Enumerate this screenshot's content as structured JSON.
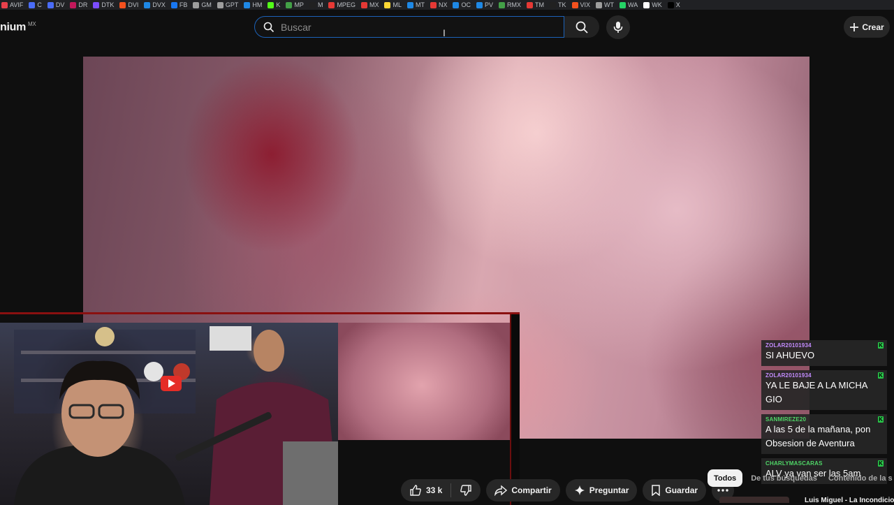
{
  "bookmarks": [
    {
      "label": "AVIF",
      "color": "#e8404b"
    },
    {
      "label": "C",
      "color": "#4a6cf7"
    },
    {
      "label": "DV",
      "color": "#4a6cf7"
    },
    {
      "label": "DR",
      "color": "#c2185b"
    },
    {
      "label": "DTK",
      "color": "#7c4dff"
    },
    {
      "label": "DVI",
      "color": "#f4511e"
    },
    {
      "label": "DVX",
      "color": "#1e88e5"
    },
    {
      "label": "FB",
      "color": "#1877f2"
    },
    {
      "label": "GM",
      "color": "#9e9e9e"
    },
    {
      "label": "GPT",
      "color": "#9e9e9e"
    },
    {
      "label": "HM",
      "color": "#1e88e5"
    },
    {
      "label": "K",
      "color": "#53fc18"
    },
    {
      "label": "MP",
      "color": "#43a047"
    },
    {
      "label": "M",
      "color": "#212121"
    },
    {
      "label": "MPEG",
      "color": "#e53935"
    },
    {
      "label": "MX",
      "color": "#e53935"
    },
    {
      "label": "ML",
      "color": "#fdd835"
    },
    {
      "label": "MT",
      "color": "#1e88e5"
    },
    {
      "label": "NX",
      "color": "#e53935"
    },
    {
      "label": "OC",
      "color": "#1e88e5"
    },
    {
      "label": "PV",
      "color": "#1e88e5"
    },
    {
      "label": "RMX",
      "color": "#43a047"
    },
    {
      "label": "TM",
      "color": "#e53935"
    },
    {
      "label": "TK",
      "color": "#212121"
    },
    {
      "label": "VIX",
      "color": "#f4511e"
    },
    {
      "label": "WT",
      "color": "#9e9e9e"
    },
    {
      "label": "WA",
      "color": "#25d366"
    },
    {
      "label": "WK",
      "color": "#ffffff"
    },
    {
      "label": "X",
      "color": "#000000"
    }
  ],
  "header": {
    "logo_text": "nium",
    "logo_region": "MX",
    "search_placeholder": "Buscar",
    "create_label": "Crear"
  },
  "chat": {
    "messages": [
      {
        "user": "ZOLAR20101934",
        "text": "SI AHUEVO",
        "user_color": "purple"
      },
      {
        "user": "ZOLAR20101934",
        "text": "YA LE BAJE A LA MICHA GIO",
        "user_color": "purple"
      },
      {
        "user": "SANMIREZE20",
        "text": "A las 5 de la mañana, pon Obsesion de Aventura",
        "user_color": "green"
      },
      {
        "user": "CHARLYMASCARAS",
        "text": "ALV ya van ser las 5am",
        "user_color": "green"
      }
    ],
    "badge": "K"
  },
  "actions": {
    "like_count": "33 k",
    "share_label": "Compartir",
    "ask_label": "Preguntar",
    "save_label": "Guardar"
  },
  "chips": [
    "Todos",
    "De tus búsquedas",
    "Contenido de la s"
  ],
  "recommendation": {
    "title": "Luis Miguel - La Incondicional"
  }
}
